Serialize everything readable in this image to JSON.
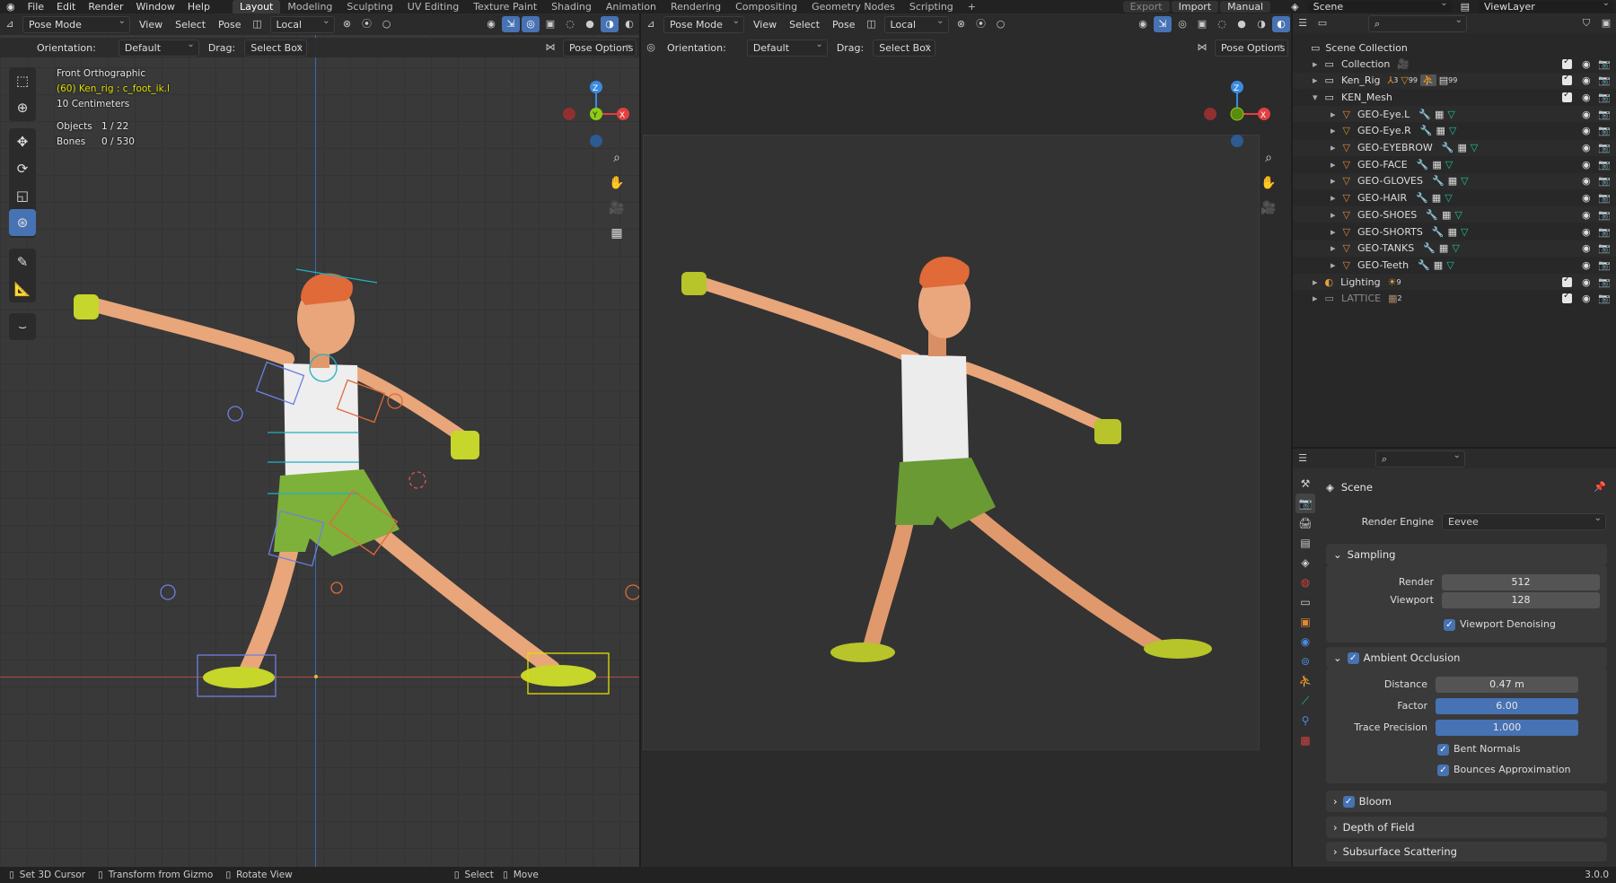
{
  "topbar": {
    "menus": [
      "File",
      "Edit",
      "Render",
      "Window",
      "Help"
    ],
    "workspaces": [
      "Layout",
      "Modeling",
      "Sculpting",
      "UV Editing",
      "Texture Paint",
      "Shading",
      "Animation",
      "Rendering",
      "Compositing",
      "Geometry Nodes",
      "Scripting"
    ],
    "active_workspace": "Layout",
    "add_tab": "+",
    "export_label": "Export",
    "import_label": "Import",
    "manual_label": "Manual",
    "scene_name": "Scene",
    "view_layer": "ViewLayer"
  },
  "left_viewport": {
    "mode": "Pose Mode",
    "menus": [
      "View",
      "Select",
      "Pose"
    ],
    "transform_orientation": "Local",
    "orientation_label": "Orientation:",
    "orientation_value": "Default",
    "drag_label": "Drag:",
    "drag_value": "Select Box",
    "pose_options": "Pose Options",
    "view_name": "Front Orthographic",
    "active_bone": "(60) Ken_rig : c_foot_ik.l",
    "grid_scale": "10 Centimeters",
    "objects_label": "Objects",
    "objects_value": "1 / 22",
    "bones_label": "Bones",
    "bones_value": "0 / 530",
    "gizmo": {
      "z": "Z",
      "y": "Y",
      "x": "X"
    }
  },
  "right_viewport": {
    "mode": "Pose Mode",
    "menus": [
      "View",
      "Select",
      "Pose"
    ],
    "transform_orientation": "Local",
    "orientation_label": "Orientation:",
    "orientation_value": "Default",
    "drag_label": "Drag:",
    "drag_value": "Select Box",
    "pose_options": "Pose Options",
    "gizmo": {
      "z": "Z",
      "x": "X"
    }
  },
  "outliner": {
    "root": "Scene Collection",
    "items": [
      {
        "label": "Collection",
        "indent": 1,
        "expand": "▸",
        "dim": false
      },
      {
        "label": "Ken_Rig",
        "indent": 1,
        "expand": "▸",
        "dim": false
      },
      {
        "label": "KEN_Mesh",
        "indent": 1,
        "expand": "▾",
        "dim": false
      },
      {
        "label": "GEO-Eye.L",
        "indent": 2,
        "expand": "▸",
        "dim": false
      },
      {
        "label": "GEO-Eye.R",
        "indent": 2,
        "expand": "▸",
        "dim": false
      },
      {
        "label": "GEO-EYEBROW",
        "indent": 2,
        "expand": "▸",
        "dim": false
      },
      {
        "label": "GEO-FACE",
        "indent": 2,
        "expand": "▸",
        "dim": false
      },
      {
        "label": "GEO-GLOVES",
        "indent": 2,
        "expand": "▸",
        "dim": false
      },
      {
        "label": "GEO-HAIR",
        "indent": 2,
        "expand": "▸",
        "dim": false
      },
      {
        "label": "GEO-SHOES",
        "indent": 2,
        "expand": "▸",
        "dim": false
      },
      {
        "label": "GEO-SHORTS",
        "indent": 2,
        "expand": "▸",
        "dim": false
      },
      {
        "label": "GEO-TANKS",
        "indent": 2,
        "expand": "▸",
        "dim": false
      },
      {
        "label": "GEO-Teeth",
        "indent": 2,
        "expand": "▸",
        "dim": false
      },
      {
        "label": "Lighting",
        "indent": 1,
        "expand": "▸",
        "dim": false
      },
      {
        "label": "LATTICE",
        "indent": 1,
        "expand": "▸",
        "dim": true
      }
    ],
    "ken_rig_counts": [
      "3",
      "99",
      "99"
    ],
    "lighting_count": "9",
    "lattice_count": "2"
  },
  "properties": {
    "context": "Scene",
    "render_engine_label": "Render Engine",
    "render_engine": "Eevee",
    "sampling": {
      "title": "Sampling",
      "render_label": "Render",
      "render_value": "512",
      "viewport_label": "Viewport",
      "viewport_value": "128",
      "denoise_label": "Viewport Denoising"
    },
    "ao": {
      "title": "Ambient Occlusion",
      "distance_label": "Distance",
      "distance_value": "0.47 m",
      "factor_label": "Factor",
      "factor_value": "6.00",
      "trace_label": "Trace Precision",
      "trace_value": "1.000",
      "bent_label": "Bent Normals",
      "bounces_label": "Bounces Approximation"
    },
    "bloom": "Bloom",
    "dof": "Depth of Field",
    "sss": "Subsurface Scattering"
  },
  "statusbar": {
    "set_cursor": "Set 3D Cursor",
    "transform_gizmo": "Transform from Gizmo",
    "rotate_view": "Rotate View",
    "select": "Select",
    "move": "Move",
    "version": "3.0.0"
  },
  "colors": {
    "accent": "#4772b3",
    "x_axis": "#e04040",
    "y_axis": "#8ccd14",
    "z_axis": "#3a8ae0",
    "active_text": "#e0e000",
    "skin": "#e8a67a",
    "hair": "#e06a38",
    "shorts": "#7db13a",
    "shoes": "#c6d62a"
  }
}
